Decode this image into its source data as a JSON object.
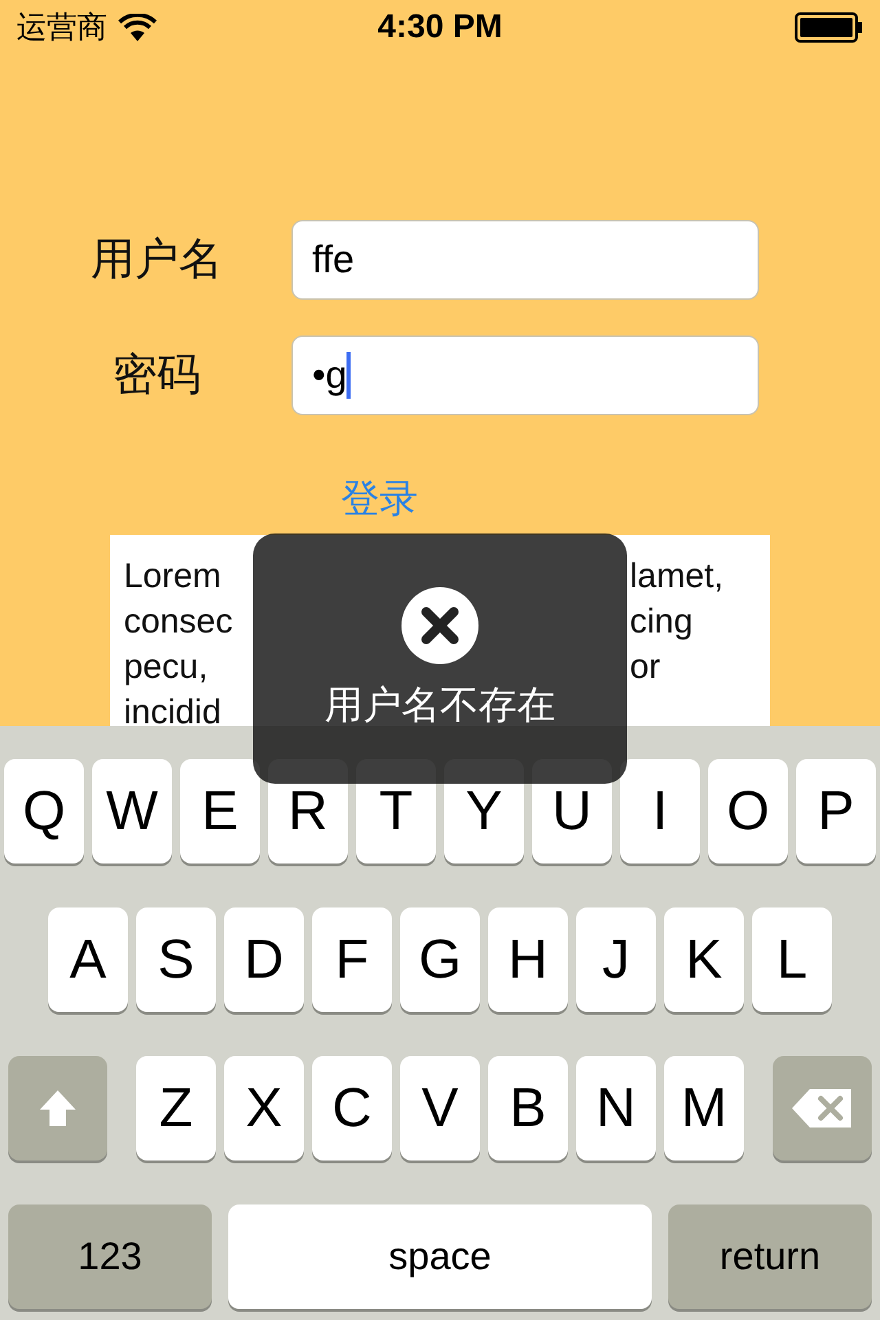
{
  "status_bar": {
    "carrier": "运营商",
    "time": "4:30 PM"
  },
  "form": {
    "fields": [
      {
        "label": "用户名",
        "value": "ffe",
        "focused": false
      },
      {
        "label": "密码",
        "value": "•g",
        "focused": true
      }
    ],
    "login_link": "登录",
    "text_view": {
      "lines": [
        {
          "left": "Lorem",
          "right": "lamet,"
        },
        {
          "left": "consec",
          "right": "cing"
        },
        {
          "left": "pecu,",
          "right": "or"
        },
        {
          "left": "incidid"
        }
      ]
    }
  },
  "toast": {
    "message": "用户名不存在"
  },
  "keyboard": {
    "rows": [
      {
        "keys": [
          {
            "kind": "letter",
            "label": "Q"
          },
          {
            "kind": "letter",
            "label": "W"
          },
          {
            "kind": "letter",
            "label": "E"
          },
          {
            "kind": "letter",
            "label": "R"
          },
          {
            "kind": "letter",
            "label": "T"
          },
          {
            "kind": "letter",
            "label": "Y"
          },
          {
            "kind": "letter",
            "label": "U"
          },
          {
            "kind": "letter",
            "label": "I"
          },
          {
            "kind": "letter",
            "label": "O"
          },
          {
            "kind": "letter",
            "label": "P"
          }
        ]
      },
      {
        "keys": [
          {
            "kind": "letter",
            "label": "A"
          },
          {
            "kind": "letter",
            "label": "S"
          },
          {
            "kind": "letter",
            "label": "D"
          },
          {
            "kind": "letter",
            "label": "F"
          },
          {
            "kind": "letter",
            "label": "G"
          },
          {
            "kind": "letter",
            "label": "H"
          },
          {
            "kind": "letter",
            "label": "J"
          },
          {
            "kind": "letter",
            "label": "K"
          },
          {
            "kind": "letter",
            "label": "L"
          }
        ]
      },
      {
        "keys": [
          {
            "kind": "shift"
          },
          {
            "kind": "letter",
            "label": "Z"
          },
          {
            "kind": "letter",
            "label": "X"
          },
          {
            "kind": "letter",
            "label": "C"
          },
          {
            "kind": "letter",
            "label": "V"
          },
          {
            "kind": "letter",
            "label": "B"
          },
          {
            "kind": "letter",
            "label": "N"
          },
          {
            "kind": "letter",
            "label": "M"
          },
          {
            "kind": "delete"
          }
        ]
      },
      {
        "keys": [
          {
            "kind": "numbers",
            "label": "123"
          },
          {
            "kind": "space",
            "label": "space"
          },
          {
            "kind": "return",
            "label": "return"
          }
        ]
      }
    ]
  }
}
